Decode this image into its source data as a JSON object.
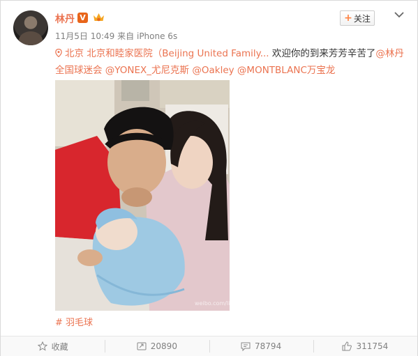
{
  "user": {
    "name": "林丹",
    "verified_badge": "V",
    "avatar_icon": "avatar-photo"
  },
  "meta": {
    "date": "11月5日 10:49",
    "source_prefix": "来自",
    "device": "iPhone 6s"
  },
  "header": {
    "follow_label": "关注",
    "follow_plus": "+",
    "more_icon": "chevron-down-icon"
  },
  "post": {
    "location": "北京 北京和睦家医院（Beijing United Family...",
    "body_text": " 欢迎你的到来芳芳辛苦了",
    "mention_1": "@林丹全国球迷会",
    "mention_2": "@YONEX_尤尼克斯",
    "mention_3": "@Oakley",
    "mention_4": "@MONTBLANC万宝龙",
    "topic_hash": "#",
    "topic": "羽毛球",
    "watermark": "weibo.com/lindan"
  },
  "actions": {
    "favorite_label": "收藏",
    "repost_count": "20890",
    "comment_count": "78794",
    "like_count": "311754"
  },
  "colors": {
    "accent": "#eb7350",
    "badge": "#e8651a",
    "muted": "#808080"
  }
}
